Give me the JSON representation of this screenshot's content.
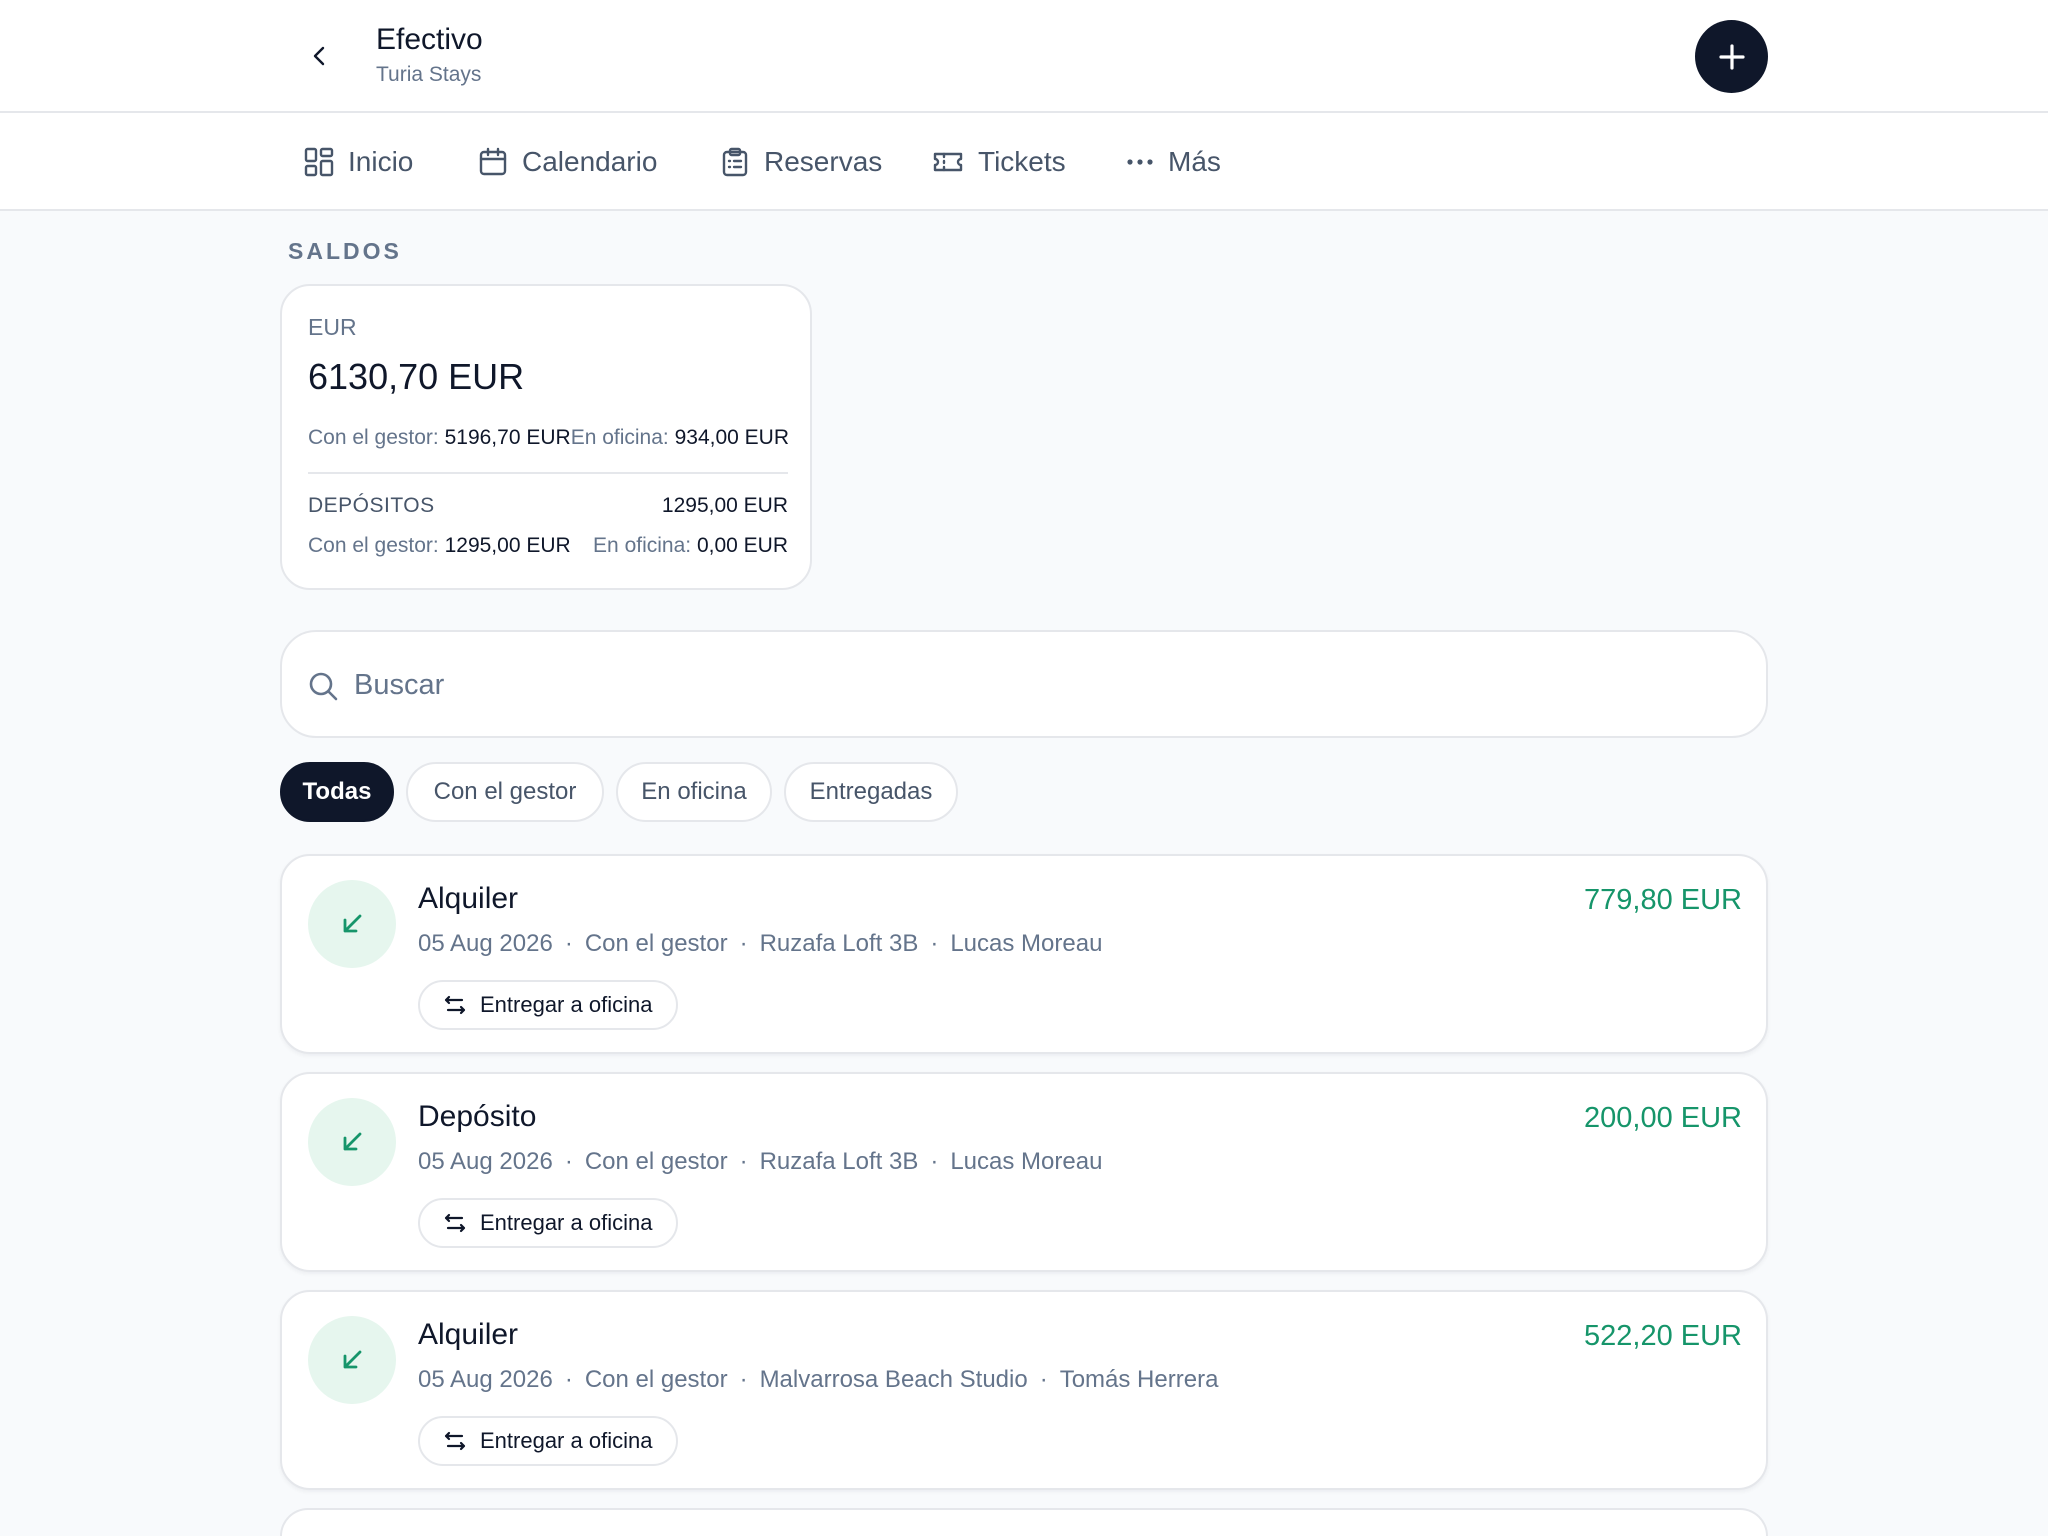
{
  "header": {
    "title": "Efectivo",
    "subtitle": "Turia Stays"
  },
  "nav": {
    "items": [
      {
        "label": "Inicio",
        "icon": "grid-icon"
      },
      {
        "label": "Calendario",
        "icon": "calendar-icon"
      },
      {
        "label": "Reservas",
        "icon": "clipboard-icon"
      },
      {
        "label": "Tickets",
        "icon": "ticket-icon"
      },
      {
        "label": "Más",
        "icon": "more-icon"
      }
    ]
  },
  "balances": {
    "section_label": "SALDOS",
    "currency": "EUR",
    "total": "6130,70 EUR",
    "manager_label": "Con el gestor:",
    "manager_value": "5196,70 EUR",
    "office_label": "En oficina:",
    "office_value": "934,00 EUR",
    "deposits_label": "DEPÓSITOS",
    "deposits_total": "1295,00 EUR",
    "dep_manager_label": "Con el gestor:",
    "dep_manager_value": "1295,00 EUR",
    "dep_office_label": "En oficina:",
    "dep_office_value": "0,00 EUR"
  },
  "search": {
    "placeholder": "Buscar"
  },
  "filters": {
    "all": "Todas",
    "manager": "Con el gestor",
    "office": "En oficina",
    "delivered": "Entregadas"
  },
  "transactions": [
    {
      "title": "Alquiler",
      "date": "05 Aug 2026",
      "status": "Con el gestor",
      "property": "Ruzafa Loft 3B",
      "guest": "Lucas Moreau",
      "amount": "779,80 EUR",
      "action": "Entregar a oficina"
    },
    {
      "title": "Depósito",
      "date": "05 Aug 2026",
      "status": "Con el gestor",
      "property": "Ruzafa Loft 3B",
      "guest": "Lucas Moreau",
      "amount": "200,00 EUR",
      "action": "Entregar a oficina"
    },
    {
      "title": "Alquiler",
      "date": "05 Aug 2026",
      "status": "Con el gestor",
      "property": "Malvarrosa Beach Studio",
      "guest": "Tomás Herrera",
      "amount": "522,20 EUR",
      "action": "Entregar a oficina"
    }
  ],
  "separator": "·",
  "colors": {
    "primary": "#0f172a",
    "positive": "#16956a",
    "positive_bg": "#e6f6ee",
    "muted": "#64748b"
  }
}
